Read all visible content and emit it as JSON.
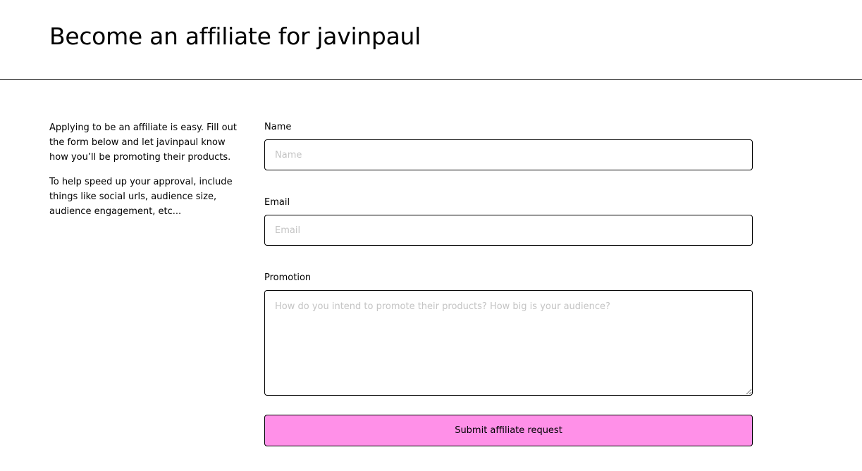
{
  "header": {
    "title": "Become an affiliate for javinpaul"
  },
  "intro": {
    "paragraph_1": "Applying to be an affiliate is easy. Fill out the form below and let javinpaul know how you’ll be promoting their products.",
    "paragraph_2": "To help speed up your approval, include things like social urls, audience size, audience engagement, etc..."
  },
  "form": {
    "name": {
      "label": "Name",
      "placeholder": "Name",
      "value": ""
    },
    "email": {
      "label": "Email",
      "placeholder": "Email",
      "value": ""
    },
    "promotion": {
      "label": "Promotion",
      "placeholder": "How do you intend to promote their products? How big is your audience?",
      "value": ""
    },
    "submit_label": "Submit affiliate request"
  },
  "colors": {
    "accent": "#ff90e8",
    "border": "#000000",
    "placeholder": "#c4c4c4"
  }
}
